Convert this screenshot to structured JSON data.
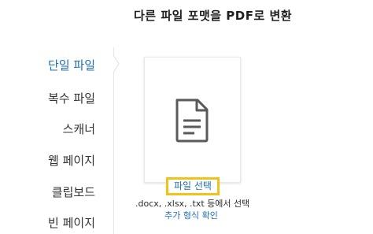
{
  "header": {
    "title": "다른 파일 포맷을 PDF로 변환"
  },
  "sidebar": {
    "items": [
      {
        "label": "단일 파일",
        "active": true
      },
      {
        "label": "복수 파일",
        "active": false
      },
      {
        "label": "스캐너",
        "active": false
      },
      {
        "label": "웹 페이지",
        "active": false
      },
      {
        "label": "클립보드",
        "active": false
      },
      {
        "label": "빈 페이지",
        "active": false
      }
    ]
  },
  "main": {
    "icon": "document-icon",
    "select_file_label": "파일 선택",
    "formats_text": ".docx, .xlsx, .txt 등에서 선택",
    "more_formats_link": "추가 형식 확인"
  },
  "colors": {
    "accent": "#1f6fb8",
    "highlight": "#f2c21a"
  }
}
